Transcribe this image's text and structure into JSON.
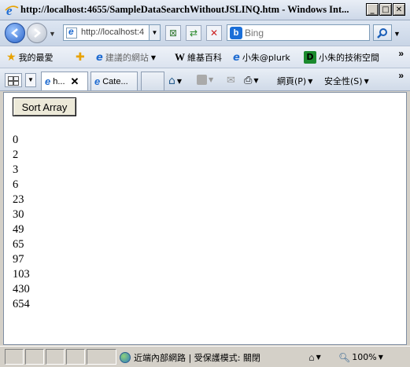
{
  "window": {
    "title": "http://localhost:4655/SampleDataSearchWithoutJSLINQ.htm - Windows Int...",
    "controls": [
      "minimize",
      "maximize",
      "close"
    ]
  },
  "address_bar": {
    "url": "http://localhost:46"
  },
  "search": {
    "placeholder": "Bing",
    "provider_icon": "bing-icon"
  },
  "favorites_bar": {
    "favorites_label": "我的最愛",
    "items": [
      {
        "label": "建議的網站",
        "icon": "ie-icon"
      },
      {
        "label": "維基百科",
        "icon": "wikipedia-icon"
      },
      {
        "label": "小朱@plurk",
        "icon": "ie-icon"
      },
      {
        "label": "小朱的技術空間",
        "icon": "d-logo-icon"
      }
    ]
  },
  "tabs": [
    {
      "label": "h...",
      "active": true
    },
    {
      "label": "Cate...",
      "active": false
    }
  ],
  "command_bar": {
    "page_label": "網頁(P)",
    "safety_label": "安全性(S)"
  },
  "content": {
    "sort_button_label": "Sort Array",
    "values": [
      "0",
      "2",
      "3",
      "6",
      "23",
      "30",
      "49",
      "65",
      "97",
      "103",
      "430",
      "654"
    ]
  },
  "status_bar": {
    "zone_text": "近端內部網路 | 受保護模式: 關閉",
    "zoom": "100%"
  }
}
